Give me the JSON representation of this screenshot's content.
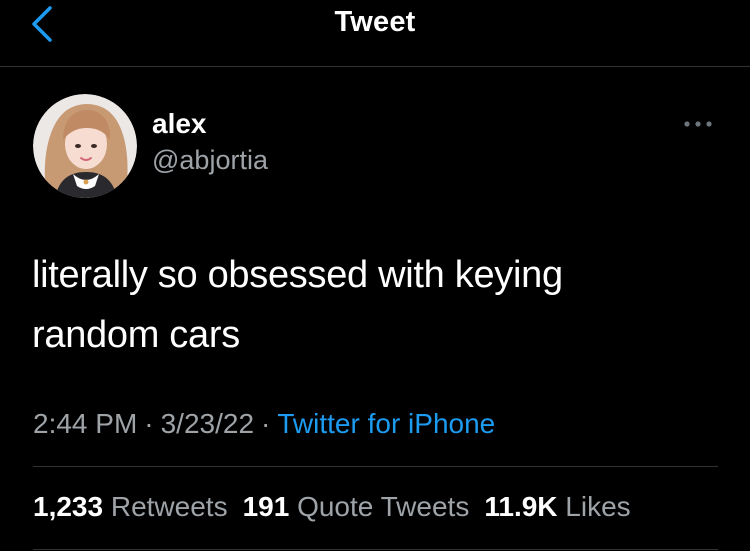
{
  "header": {
    "title": "Tweet",
    "back_icon": "chevron-left-icon"
  },
  "tweet": {
    "author": {
      "display_name": "alex",
      "handle": "@abjortia"
    },
    "more_icon": "ellipsis-icon",
    "text_lines": [
      "literally so obsessed with keying",
      "random cars"
    ],
    "time": "2:44 PM",
    "date": "3/23/22",
    "separator": "·",
    "source": "Twitter for iPhone",
    "stats": {
      "retweets_count": "1,233",
      "retweets_label": "Retweets",
      "quotes_count": "191",
      "quotes_label": "Quote Tweets",
      "likes_count": "11.9K",
      "likes_label": "Likes"
    }
  },
  "colors": {
    "background": "#000000",
    "text_primary": "#ffffff",
    "text_secondary": "#9ea3a8",
    "accent": "#1d9bf0",
    "divider": "#2f3336"
  }
}
